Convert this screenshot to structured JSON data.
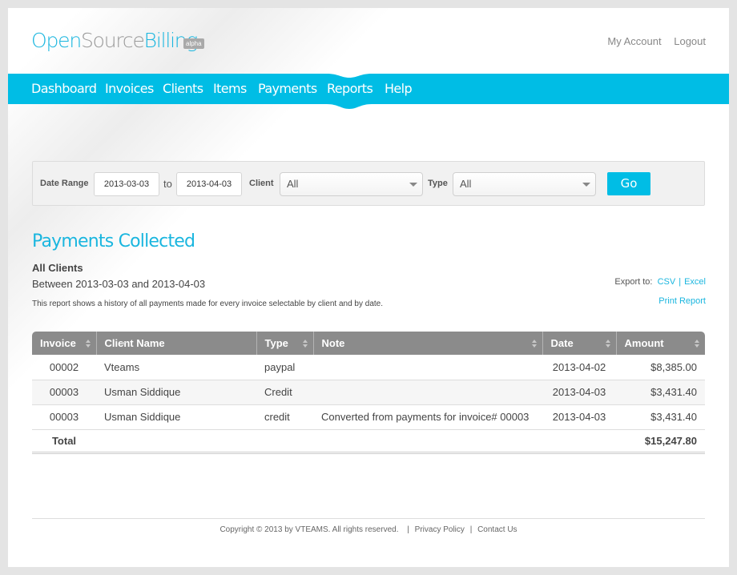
{
  "brand": {
    "logo_part1": "Open",
    "logo_part2": "Source",
    "logo_part3": "Billing",
    "badge": "alpha",
    "accent_color": "#00bde5"
  },
  "account_links": {
    "my_account": "My Account",
    "logout": "Logout"
  },
  "nav": {
    "items": [
      "Dashboard",
      "Invoices",
      "Clients",
      "Items",
      "Payments",
      "Reports",
      "Help"
    ],
    "active": "Reports"
  },
  "filter": {
    "date_range_label": "Date Range",
    "date_from": "2013-03-03",
    "to_label": "to",
    "date_to": "2013-04-03",
    "client_label": "Client",
    "client_value": "All",
    "type_label": "Type",
    "type_value": "All",
    "go_label": "Go"
  },
  "report": {
    "title": "Payments Collected",
    "client_scope": "All Clients",
    "period": "Between 2013-03-03 and 2013-04-03",
    "description": "This report shows a history of all payments made for every invoice selectable by client and by date.",
    "export_label": "Export to:",
    "export_csv": "CSV",
    "export_sep": "|",
    "export_excel": "Excel",
    "print_label": "Print Report"
  },
  "table": {
    "columns": [
      "Invoice",
      "Client Name",
      "Type",
      "Note",
      "Date",
      "Amount"
    ],
    "sorted_column": "Client Name",
    "rows": [
      {
        "invoice": "00002",
        "client": "Vteams",
        "type": "paypal",
        "note": "",
        "date": "2013-04-02",
        "amount": "$8,385.00"
      },
      {
        "invoice": "00003",
        "client": "Usman Siddique",
        "type": "Credit",
        "note": "",
        "date": "2013-04-03",
        "amount": "$3,431.40"
      },
      {
        "invoice": "00003",
        "client": "Usman Siddique",
        "type": "credit",
        "note": "Converted from payments for invoice# 00003",
        "date": "2013-04-03",
        "amount": "$3,431.40"
      }
    ],
    "total_label": "Total",
    "total_amount": "$15,247.80"
  },
  "footer": {
    "copyright": "Copyright © 2013 by VTEAMS. All rights reserved.",
    "sep": "|",
    "privacy": "Privacy Policy",
    "contact": "Contact Us"
  }
}
